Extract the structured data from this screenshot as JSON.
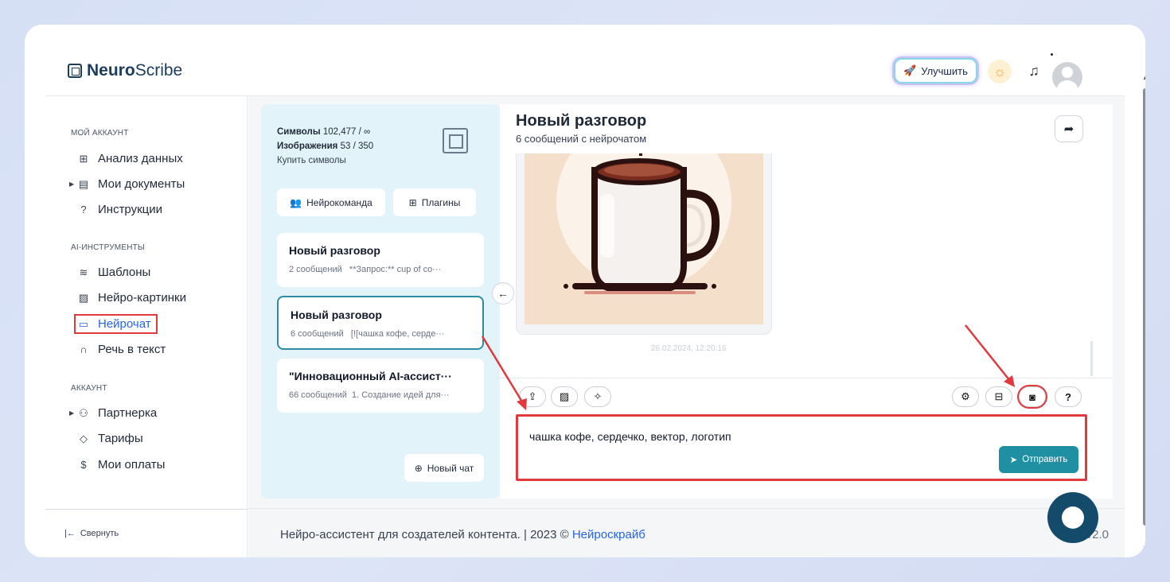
{
  "header": {
    "logo_bold": "Neuro",
    "logo_rest": "Scribe",
    "upgrade_label": "Улучшить"
  },
  "sidebar": {
    "section_account": "МОЙ АККАУНТ",
    "items_account": [
      "Анализ данных",
      "Мои документы",
      "Инструкции"
    ],
    "section_ai": "AI-ИНСТРУМЕНТЫ",
    "items_ai": [
      "Шаблоны",
      "Нейро-картинки",
      "Нейрочат",
      "Речь в текст"
    ],
    "section_acc2": "АККАУНТ",
    "items_acc2": [
      "Партнерка",
      "Тарифы",
      "Мои оплаты"
    ],
    "collapse_label": "Свернуть"
  },
  "panel": {
    "symbols_label": "Символы",
    "symbols_value": "102,477 / ∞",
    "images_label": "Изображения",
    "images_value": "53 / 350",
    "buy_label": "Купить символы",
    "team_button": "Нейрокоманда",
    "plugins_button": "Плагины",
    "conversations": [
      {
        "title": "Новый разговор",
        "meta": "2 сообщений",
        "preview": "**Запрос:** cup of co···"
      },
      {
        "title": "Новый разговор",
        "meta": "6 сообщений",
        "preview": "[![чашка кофе, серде···"
      },
      {
        "title": "\"Инновационный AI-ассист···",
        "meta": "66 сообщений",
        "preview": "1. Создание идей для···"
      }
    ],
    "new_chat": "Новый чат"
  },
  "chat": {
    "title": "Новый разговор",
    "subtitle": "6 сообщений с нейрочатом",
    "timestamp": "26.02.2024, 12:20:16",
    "input_value": "чашка кофе, сердечко, вектор, логотип",
    "send_label": "Отправить",
    "help_label": "?"
  },
  "footer": {
    "text": "Нейро-ассистент для создателей контента.  | 2023 © ",
    "link": "Нейроскрайб",
    "version": "v2.0"
  },
  "colors": {
    "accent": "#1f8fa2",
    "annotation": "#e0393e",
    "panel_bg": "#e3f3fa"
  }
}
